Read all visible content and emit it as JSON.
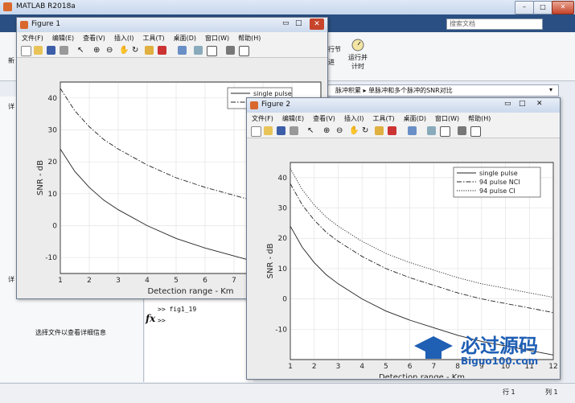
{
  "app": {
    "title": "MATLAB R2018a",
    "colors": {
      "accent": "#2a4f82",
      "titlebar": "#c6d6ec"
    }
  },
  "ribbon": {
    "search_placeholder": "搜索文档",
    "run_button": "运行并\n计时",
    "left_fragment": "新",
    "section_fragment": "行节",
    "section_fragment2": "进"
  },
  "address_bar": {
    "path": "脉冲积累  ▸  单脉冲和多个脉冲的SNR对比"
  },
  "left_panel": {
    "detail_text": "选择文件以查看详细信息",
    "side_label": "详"
  },
  "command_window": {
    "prompt_line1": ">> fig1_19",
    "prompt_line2": ">>",
    "fx_icon": "fx"
  },
  "status": {
    "row_label": "行 1",
    "col_label": "列 1"
  },
  "menus": [
    "文件(F)",
    "编辑(E)",
    "查看(V)",
    "插入(I)",
    "工具(T)",
    "桌面(D)",
    "窗口(W)",
    "帮助(H)"
  ],
  "figure1": {
    "title": "Figure 1",
    "chart_data": {
      "type": "line",
      "xlabel": "Detection range - Km",
      "ylabel": "SNR - dB",
      "xlim": [
        1,
        10
      ],
      "ylim": [
        -15,
        45
      ],
      "grid": true,
      "legend_position": "top-right",
      "xticks": [
        1,
        2,
        3,
        4,
        5,
        6,
        7,
        8,
        9
      ],
      "yticks": [
        -10,
        0,
        10,
        20,
        30,
        40
      ],
      "series": [
        {
          "name": "single pulse",
          "style": "solid",
          "x": [
            1,
            1.5,
            2,
            2.5,
            3,
            4,
            5,
            6,
            7,
            8,
            9,
            10
          ],
          "y": [
            24,
            17,
            12,
            8,
            5,
            0,
            -4,
            -7,
            -9.5,
            -12,
            -14,
            -15.5
          ]
        },
        {
          "name": "",
          "style": "dashdot",
          "x": [
            1,
            1.5,
            2,
            2.5,
            3,
            4,
            5,
            6,
            7,
            8,
            9,
            10
          ],
          "y": [
            43,
            36,
            31,
            27,
            24,
            19,
            15,
            12,
            9.5,
            7,
            5,
            3.5
          ]
        }
      ]
    }
  },
  "figure2": {
    "title": "Figure 2",
    "chart_data": {
      "type": "line",
      "xlabel": "Detection range - Km",
      "ylabel": "SNR - dB",
      "xlim": [
        1,
        12
      ],
      "ylim": [
        -20,
        45
      ],
      "grid": true,
      "legend_position": "top-right",
      "xticks": [
        1,
        2,
        3,
        4,
        5,
        6,
        7,
        8,
        9,
        10,
        11,
        12
      ],
      "yticks": [
        -10,
        0,
        10,
        20,
        30,
        40
      ],
      "series": [
        {
          "name": "single pulse",
          "style": "solid",
          "x": [
            1,
            1.5,
            2,
            2.5,
            3,
            4,
            5,
            6,
            7,
            8,
            9,
            10,
            11,
            12
          ],
          "y": [
            24,
            17,
            12,
            8,
            5,
            0,
            -4,
            -7,
            -9.5,
            -12,
            -14,
            -15.5,
            -17,
            -18.5
          ]
        },
        {
          "name": "94 pulse NCI",
          "style": "dashdot",
          "x": [
            1,
            1.5,
            2,
            2.5,
            3,
            4,
            5,
            6,
            7,
            8,
            9,
            10,
            11,
            12
          ],
          "y": [
            38,
            31,
            26,
            22,
            19,
            14,
            10,
            7,
            4.5,
            2,
            0,
            -1.5,
            -3,
            -4.5
          ]
        },
        {
          "name": "94 pulse CI",
          "style": "dotted",
          "x": [
            1,
            1.5,
            2,
            2.5,
            3,
            4,
            5,
            6,
            7,
            8,
            9,
            10,
            11,
            12
          ],
          "y": [
            43,
            36,
            31,
            27,
            24,
            19,
            15,
            12,
            9.5,
            7,
            5,
            3.5,
            2,
            0.5
          ]
        }
      ]
    }
  },
  "watermark": {
    "brand": "必过源码",
    "url": "Biguo100.com"
  }
}
